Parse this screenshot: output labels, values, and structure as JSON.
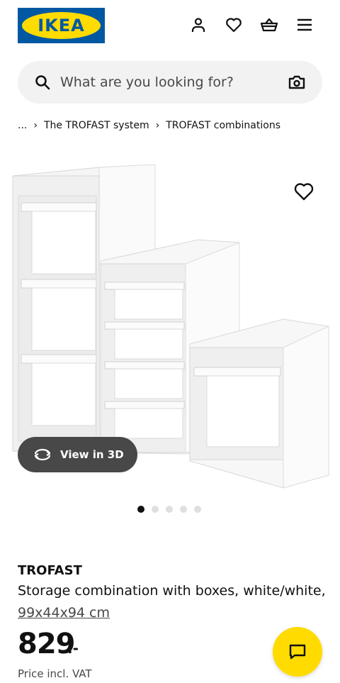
{
  "header": {
    "logo_text": "IKEA",
    "icons": [
      "user-icon",
      "heart-icon",
      "basket-icon",
      "menu-icon"
    ]
  },
  "search": {
    "placeholder": "What are you looking for?",
    "icons": [
      "search-icon",
      "camera-icon"
    ]
  },
  "breadcrumb": {
    "items": [
      "...",
      "The TROFAST system",
      "TROFAST combinations"
    ]
  },
  "gallery": {
    "view3d_label": "View in 3D",
    "dot_count": 5,
    "active_dot": 1
  },
  "product": {
    "name": "TROFAST",
    "description": "Storage combination with boxes, white/white,",
    "dimensions": "99x44x94 cm",
    "price": "829",
    "price_suffix": ".-",
    "vat_note": "Price incl. VAT"
  },
  "colors": {
    "brand_blue": "#0058a3",
    "brand_yellow": "#ffdb00",
    "text_dark": "#111111",
    "text_gray": "#484848",
    "search_bg": "#f2f2f2"
  }
}
